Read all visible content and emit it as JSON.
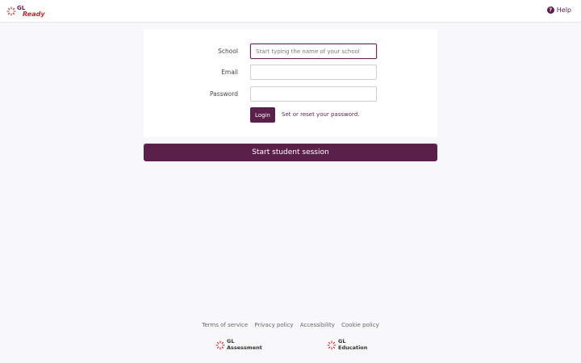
{
  "header": {
    "logo_line1": "GL",
    "logo_line2": "Ready",
    "help_label": "Help"
  },
  "form": {
    "school_label": "School",
    "school_placeholder": "Start typing the name of your school",
    "school_value": "",
    "email_label": "Email",
    "email_value": "",
    "password_label": "Password",
    "password_value": "",
    "login_label": "Login",
    "reset_link": "Set or reset your password."
  },
  "student_session_label": "Start student session",
  "footer": {
    "links": [
      "Terms of service",
      "Privacy policy",
      "Accessibility",
      "Cookie policy"
    ],
    "logo_assessment": {
      "line1": "GL",
      "line2": "Assessment"
    },
    "logo_education": {
      "line1": "GL",
      "line2": "Education"
    }
  },
  "colors": {
    "brand": "#5a1f4a",
    "accent_red": "#c8242f",
    "background": "#f8f8fa"
  },
  "icons": {
    "help": "question-circle-icon",
    "logo_mark": "starburst-icon"
  }
}
